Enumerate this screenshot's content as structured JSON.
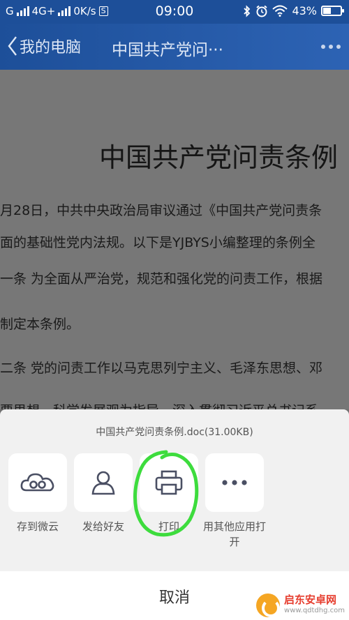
{
  "status_bar": {
    "carrier_left": "G",
    "network": "4G+",
    "speed": "0K/s",
    "storage_badge": "S",
    "time": "09:00",
    "battery": "43%",
    "battery_level": 0.43,
    "icons": [
      "signal-icon",
      "bluetooth-icon",
      "alarm-icon",
      "wifi-icon",
      "battery-icon"
    ]
  },
  "title_bar": {
    "back_label": "我的电脑",
    "doc_title": "中国共产党问···"
  },
  "document": {
    "heading": "中国共产党问责条例",
    "paragraphs": [
      "月28日，中共中央政治局审议通过《中国共产党问责条",
      "面的基础性党内法规。以下是YJBYS小编整理的条例全",
      "一条  为全面从严治党，规范和强化党的问责工作，根据",
      "制定本条例。",
      "二条  党的问责工作以马克思列宁主义、毛泽东思想、邓",
      "要思想、科学发展观为指导，深入贯彻习近平总书记系"
    ]
  },
  "share_sheet": {
    "file_name": "中国共产党问责条例.doc(31.00KB)",
    "actions": [
      {
        "label": "存到微云",
        "icon": "cloud-icon"
      },
      {
        "label": "发给好友",
        "icon": "person-icon"
      },
      {
        "label": "打印",
        "icon": "printer-icon"
      },
      {
        "label": "用其他应用打开",
        "icon": "more-icon"
      }
    ],
    "cancel_label": "取消"
  },
  "annotation": {
    "color": "#3ddc3d"
  },
  "watermark": {
    "name": "启东安卓网",
    "url": "www.qdtdhg.com"
  }
}
